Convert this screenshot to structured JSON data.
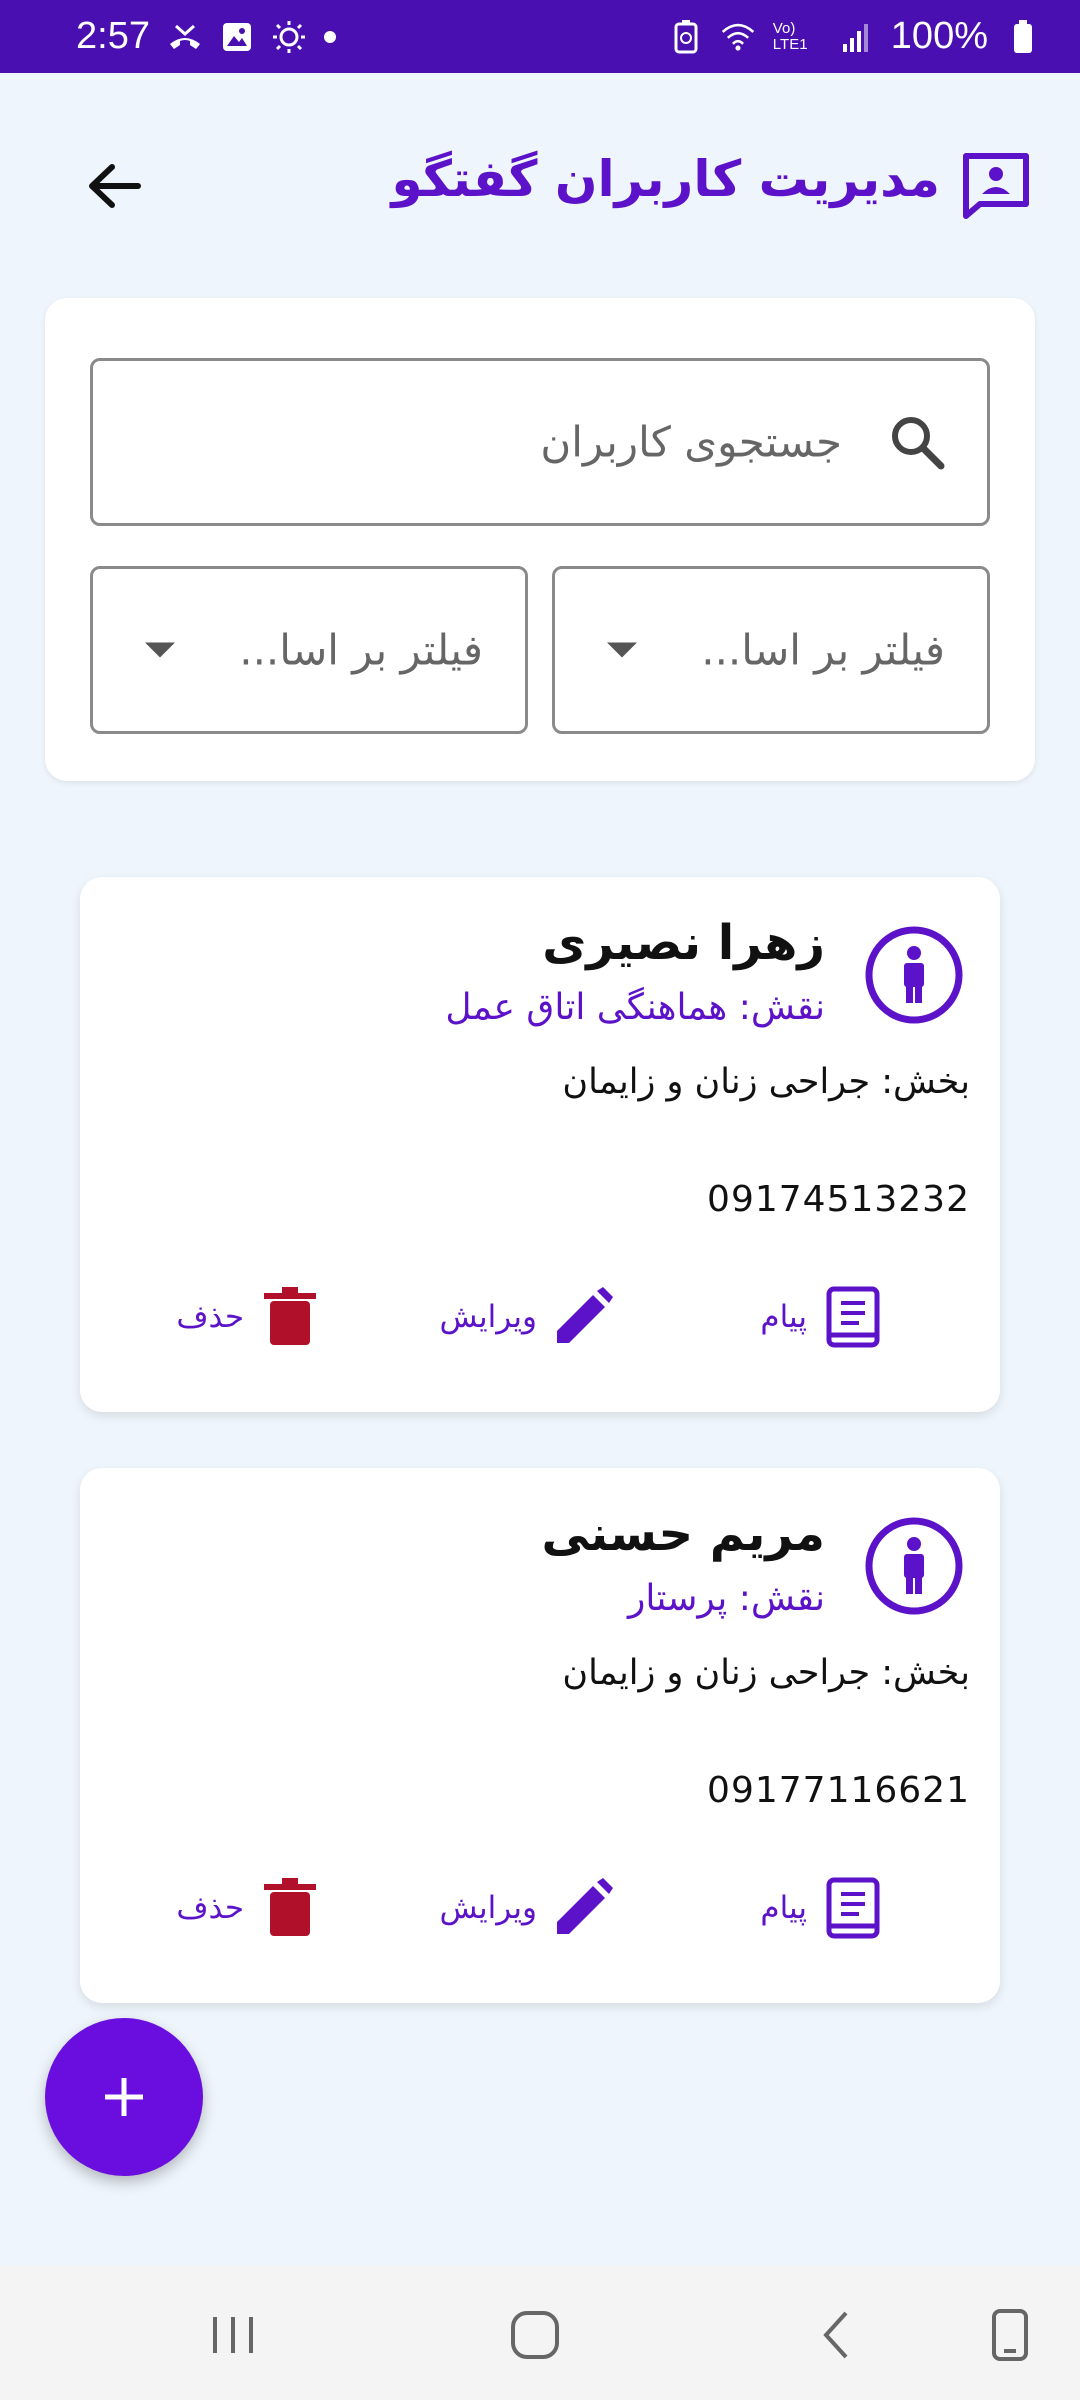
{
  "status_bar": {
    "time": "2:57",
    "battery": "100%",
    "network": "Vo) LTE1"
  },
  "header": {
    "title": "مدیریت کاربران گفتگو"
  },
  "filters": {
    "search_placeholder": "جستجوی کاربران",
    "filter_1": "فیلتر بر اسا...",
    "filter_2": "فیلتر بر اسا..."
  },
  "users": [
    {
      "name": "زهرا نصیری",
      "role": "نقش: هماهنگی اتاق عمل",
      "department": "بخش: جراحی زنان و زایمان",
      "phone": "09174513232"
    },
    {
      "name": "مریم حسنی",
      "role": "نقش: پرستار",
      "department": "بخش: جراحی زنان و زایمان",
      "phone": "09177116621"
    }
  ],
  "actions": {
    "message": "پیام",
    "edit": "ویرایش",
    "delete": "حذف"
  },
  "colors": {
    "accent": "#5b12c9",
    "status_bar": "#4a0fb0",
    "fab": "#6a0ee0",
    "delete": "#b0102a"
  }
}
